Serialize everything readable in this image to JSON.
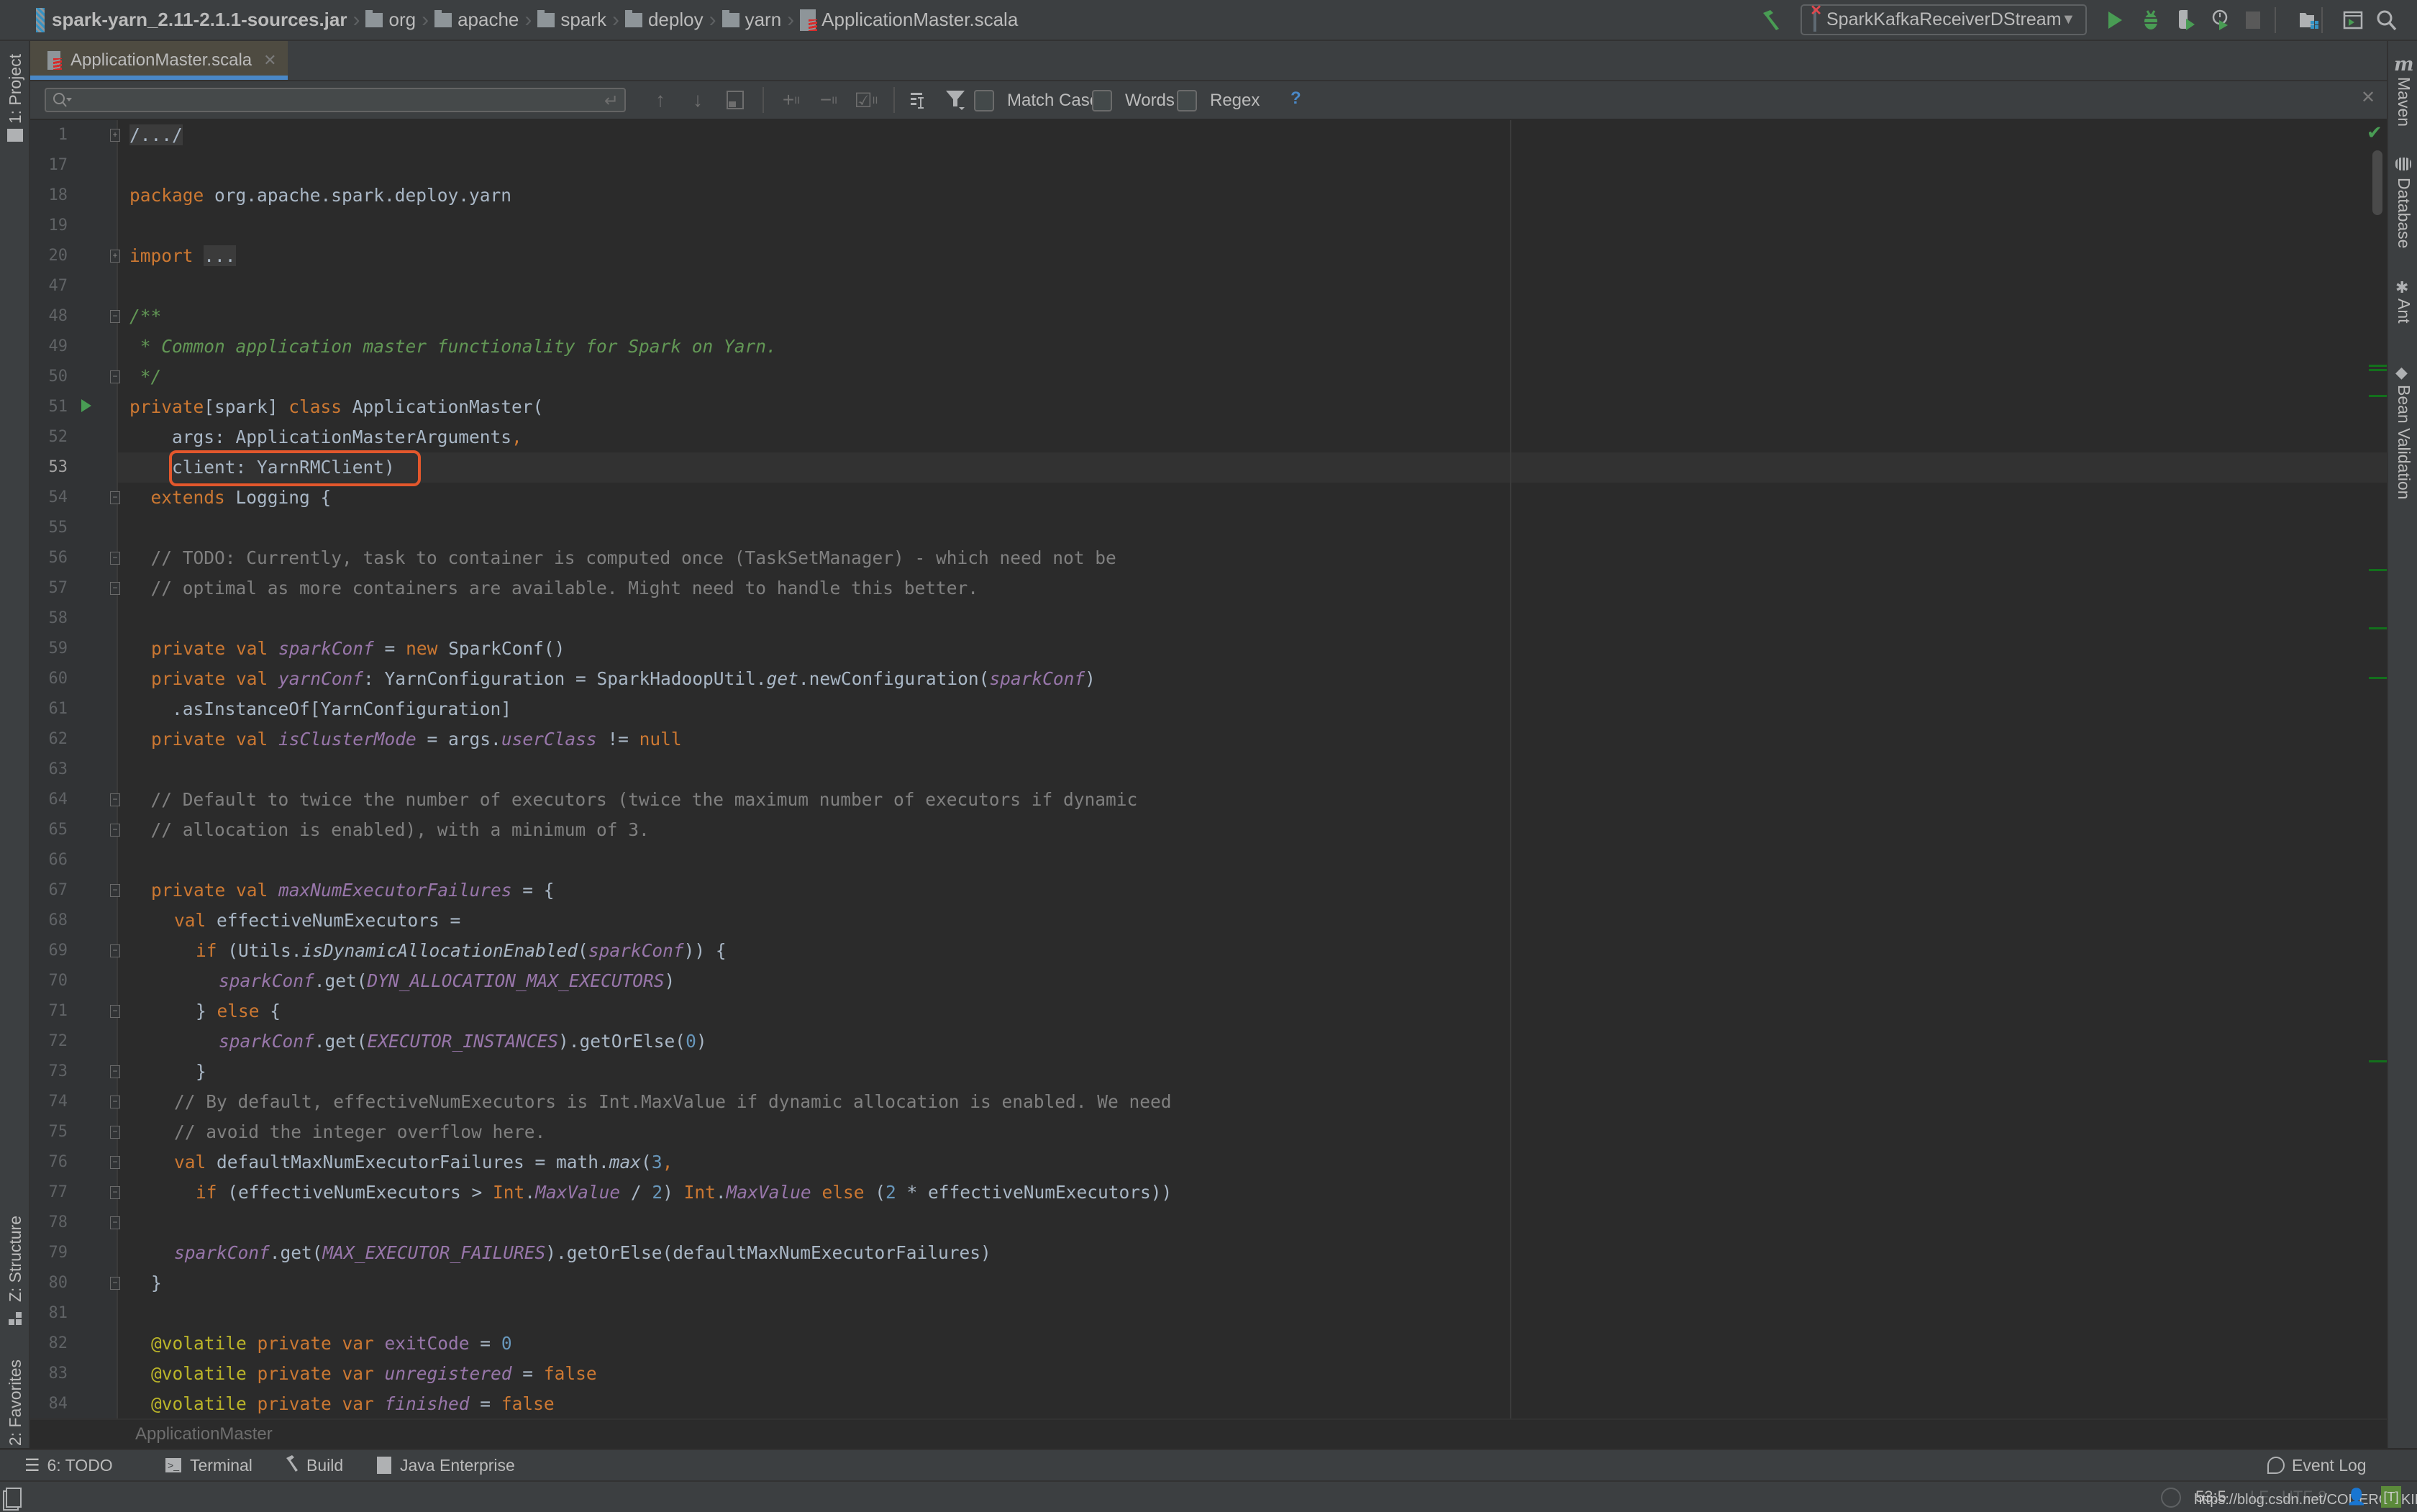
{
  "navbar": {
    "breadcrumb": [
      {
        "label": "spark-yarn_2.11-2.1.1-sources.jar",
        "icon": "jar-icon"
      },
      {
        "label": "org",
        "icon": "folder-icon"
      },
      {
        "label": "apache",
        "icon": "folder-icon"
      },
      {
        "label": "spark",
        "icon": "folder-icon"
      },
      {
        "label": "deploy",
        "icon": "folder-icon"
      },
      {
        "label": "yarn",
        "icon": "folder-icon"
      },
      {
        "label": "ApplicationMaster.scala",
        "icon": "scala-file-icon"
      }
    ],
    "run_config": "SparkKafkaReceiverDStream",
    "toolbar_icons": [
      "build-hammer-icon",
      "run-icon",
      "debug-icon",
      "coverage-icon",
      "profile-icon",
      "stop-icon",
      "project-structure-icon",
      "terminal-window-icon",
      "search-everywhere-icon"
    ]
  },
  "tabs": [
    {
      "label": "ApplicationMaster.scala",
      "active": true,
      "icon": "scala-file-icon"
    }
  ],
  "findbar": {
    "search_value": "",
    "options": [
      {
        "label": "Match Case",
        "checked": false
      },
      {
        "label": "Words",
        "checked": false
      },
      {
        "label": "Regex",
        "checked": false
      }
    ],
    "help": "?"
  },
  "left_stripe": {
    "top": {
      "label": "1: Project"
    },
    "bottom": [
      {
        "label": "Z: Structure"
      },
      {
        "label": "2: Favorites"
      }
    ]
  },
  "right_stripe": [
    {
      "label": "Maven"
    },
    {
      "label": "Database"
    },
    {
      "label": "Ant"
    },
    {
      "label": "Bean Validation"
    }
  ],
  "editor": {
    "current_line": "53",
    "highlighted": "client: YarnRMClient)",
    "lines": [
      {
        "n": "1"
      },
      {
        "n": "17"
      },
      {
        "n": "18"
      },
      {
        "n": "19"
      },
      {
        "n": "20"
      },
      {
        "n": "47"
      },
      {
        "n": "48"
      },
      {
        "n": "49"
      },
      {
        "n": "50"
      },
      {
        "n": "51"
      },
      {
        "n": "52"
      },
      {
        "n": "53"
      },
      {
        "n": "54"
      },
      {
        "n": "55"
      },
      {
        "n": "56"
      },
      {
        "n": "57"
      },
      {
        "n": "58"
      },
      {
        "n": "59"
      },
      {
        "n": "60"
      },
      {
        "n": "61"
      },
      {
        "n": "62"
      },
      {
        "n": "63"
      },
      {
        "n": "64"
      },
      {
        "n": "65"
      },
      {
        "n": "66"
      },
      {
        "n": "67"
      },
      {
        "n": "68"
      },
      {
        "n": "69"
      },
      {
        "n": "70"
      },
      {
        "n": "71"
      },
      {
        "n": "72"
      },
      {
        "n": "73"
      },
      {
        "n": "74"
      },
      {
        "n": "75"
      },
      {
        "n": "76"
      },
      {
        "n": "77"
      },
      {
        "n": "78"
      },
      {
        "n": "79"
      },
      {
        "n": "80"
      },
      {
        "n": "81"
      },
      {
        "n": "82"
      },
      {
        "n": "83"
      },
      {
        "n": "84"
      }
    ],
    "tokens": {
      "l1": "/.../",
      "l18_kw": "package",
      "l18": " org.apache.spark.deploy.yarn",
      "l20_kw": "import",
      "l20_fold": "...",
      "l48": "/**",
      "l49": " * Common application master functionality for Spark on Yarn.",
      "l50": " */",
      "l51_a": "private",
      "l51_b": "[spark] ",
      "l51_c": "class",
      "l51_d": " ApplicationMaster(",
      "l52_a": "    args: ApplicationMasterArguments",
      "l52_b": ",",
      "l53": "    client: YarnRMClient)",
      "l54_a": "  ",
      "l54_b": "extends",
      "l54_c": " Logging {",
      "l56": "  // TODO: Currently, task to container is computed once (TaskSetManager) - which need not be",
      "l57": "  // optimal as more containers are available. Might need to handle this better.",
      "l59_a": "private val",
      "l59_b": "sparkConf",
      "l59_c": " = ",
      "l59_d": "new",
      "l59_e": " SparkConf()",
      "l60_a": "private val",
      "l60_b": "yarnConf",
      "l60_c": ": YarnConfiguration = SparkHadoopUtil.",
      "l60_d": "get",
      "l60_e": ".newConfiguration(",
      "l60_f": "sparkConf",
      "l60_g": ")",
      "l61": "    .asInstanceOf[YarnConfiguration]",
      "l62_a": "private val",
      "l62_b": "isClusterMode",
      "l62_c": " = args.",
      "l62_d": "userClass",
      "l62_e": " != ",
      "l62_f": "null",
      "l64": "  // Default to twice the number of executors (twice the maximum number of executors if dynamic",
      "l65": "  // allocation is enabled), with a minimum of 3.",
      "l67_a": "private val",
      "l67_b": "maxNumExecutorFailures",
      "l67_c": " = {",
      "l68_a": "val",
      "l68_b": " effectiveNumExecutors =",
      "l69_a": "if",
      "l69_b": " (Utils.",
      "l69_c": "isDynamicAllocationEnabled",
      "l69_d": "(",
      "l69_e": "sparkConf",
      "l69_f": ")) {",
      "l70_a": "sparkConf",
      "l70_b": ".get(",
      "l70_c": "DYN_ALLOCATION_MAX_EXECUTORS",
      "l70_d": ")",
      "l71_a": "} ",
      "l71_b": "else",
      "l71_c": " {",
      "l72_a": "sparkConf",
      "l72_b": ".get(",
      "l72_c": "EXECUTOR_INSTANCES",
      "l72_d": ").getOrElse(",
      "l72_e": "0",
      "l72_f": ")",
      "l73": "}",
      "l74": "// By default, effectiveNumExecutors is Int.MaxValue if dynamic allocation is enabled. We need",
      "l75": "// avoid the integer overflow here.",
      "l76_a": "val",
      "l76_b": " defaultMaxNumExecutorFailures = math.",
      "l76_c": "max",
      "l76_d": "(",
      "l76_e": "3",
      "l76_f": ",",
      "l77_a": "if",
      "l77_b": " (effectiveNumExecutors > ",
      "l77_c": "Int",
      "l77_d": ".",
      "l77_e": "MaxValue",
      "l77_f": " / ",
      "l77_g": "2",
      "l77_h": ") ",
      "l77_i": "Int",
      "l77_j": ".",
      "l77_k": "MaxValue",
      "l77_l": " ",
      "l77_m": "else",
      "l77_n": " (",
      "l77_o": "2",
      "l77_p": " * effectiveNumExecutors))",
      "l79_a": "sparkConf",
      "l79_b": ".get(",
      "l79_c": "MAX_EXECUTOR_FAILURES",
      "l79_d": ").getOrElse(defaultMaxNumExecutorFailures)",
      "l80": "}",
      "l82_a": "@volatile",
      "l82_b": " private var ",
      "l82_c": "exitCode",
      "l82_d": " = ",
      "l82_e": "0",
      "l83_a": "@volatile",
      "l83_b": " private var ",
      "l83_c": "unregistered",
      "l83_d": " = ",
      "l83_e": "false",
      "l84_a": "@volatile",
      "l84_b": " private var ",
      "l84_c": "finished",
      "l84_d": " = ",
      "l84_e": "false"
    },
    "footer_breadcrumb": "ApplicationMaster"
  },
  "bottom_tools": [
    {
      "label": "6: TODO",
      "icon": "todo-list-icon"
    },
    {
      "label": "Terminal",
      "icon": "terminal-icon"
    },
    {
      "label": "Build",
      "icon": "build-hammer-icon"
    },
    {
      "label": "Java Enterprise",
      "icon": "java-enterprise-icon"
    }
  ],
  "event_log": "Event Log",
  "status": {
    "caret_position": "53:5",
    "line_separator": "LF",
    "encoding": "UTF-8",
    "watermark": "https://blog.csdn.net/CODEROOKIE_RUN"
  },
  "colors": {
    "highlight_box": "#e3572c",
    "accent_tab": "#4a88c7",
    "keyword": "#cc7832",
    "comment": "#808080",
    "doc_comment": "#629755",
    "field": "#9876aa",
    "number": "#6897bb",
    "annotation": "#bbb529"
  }
}
